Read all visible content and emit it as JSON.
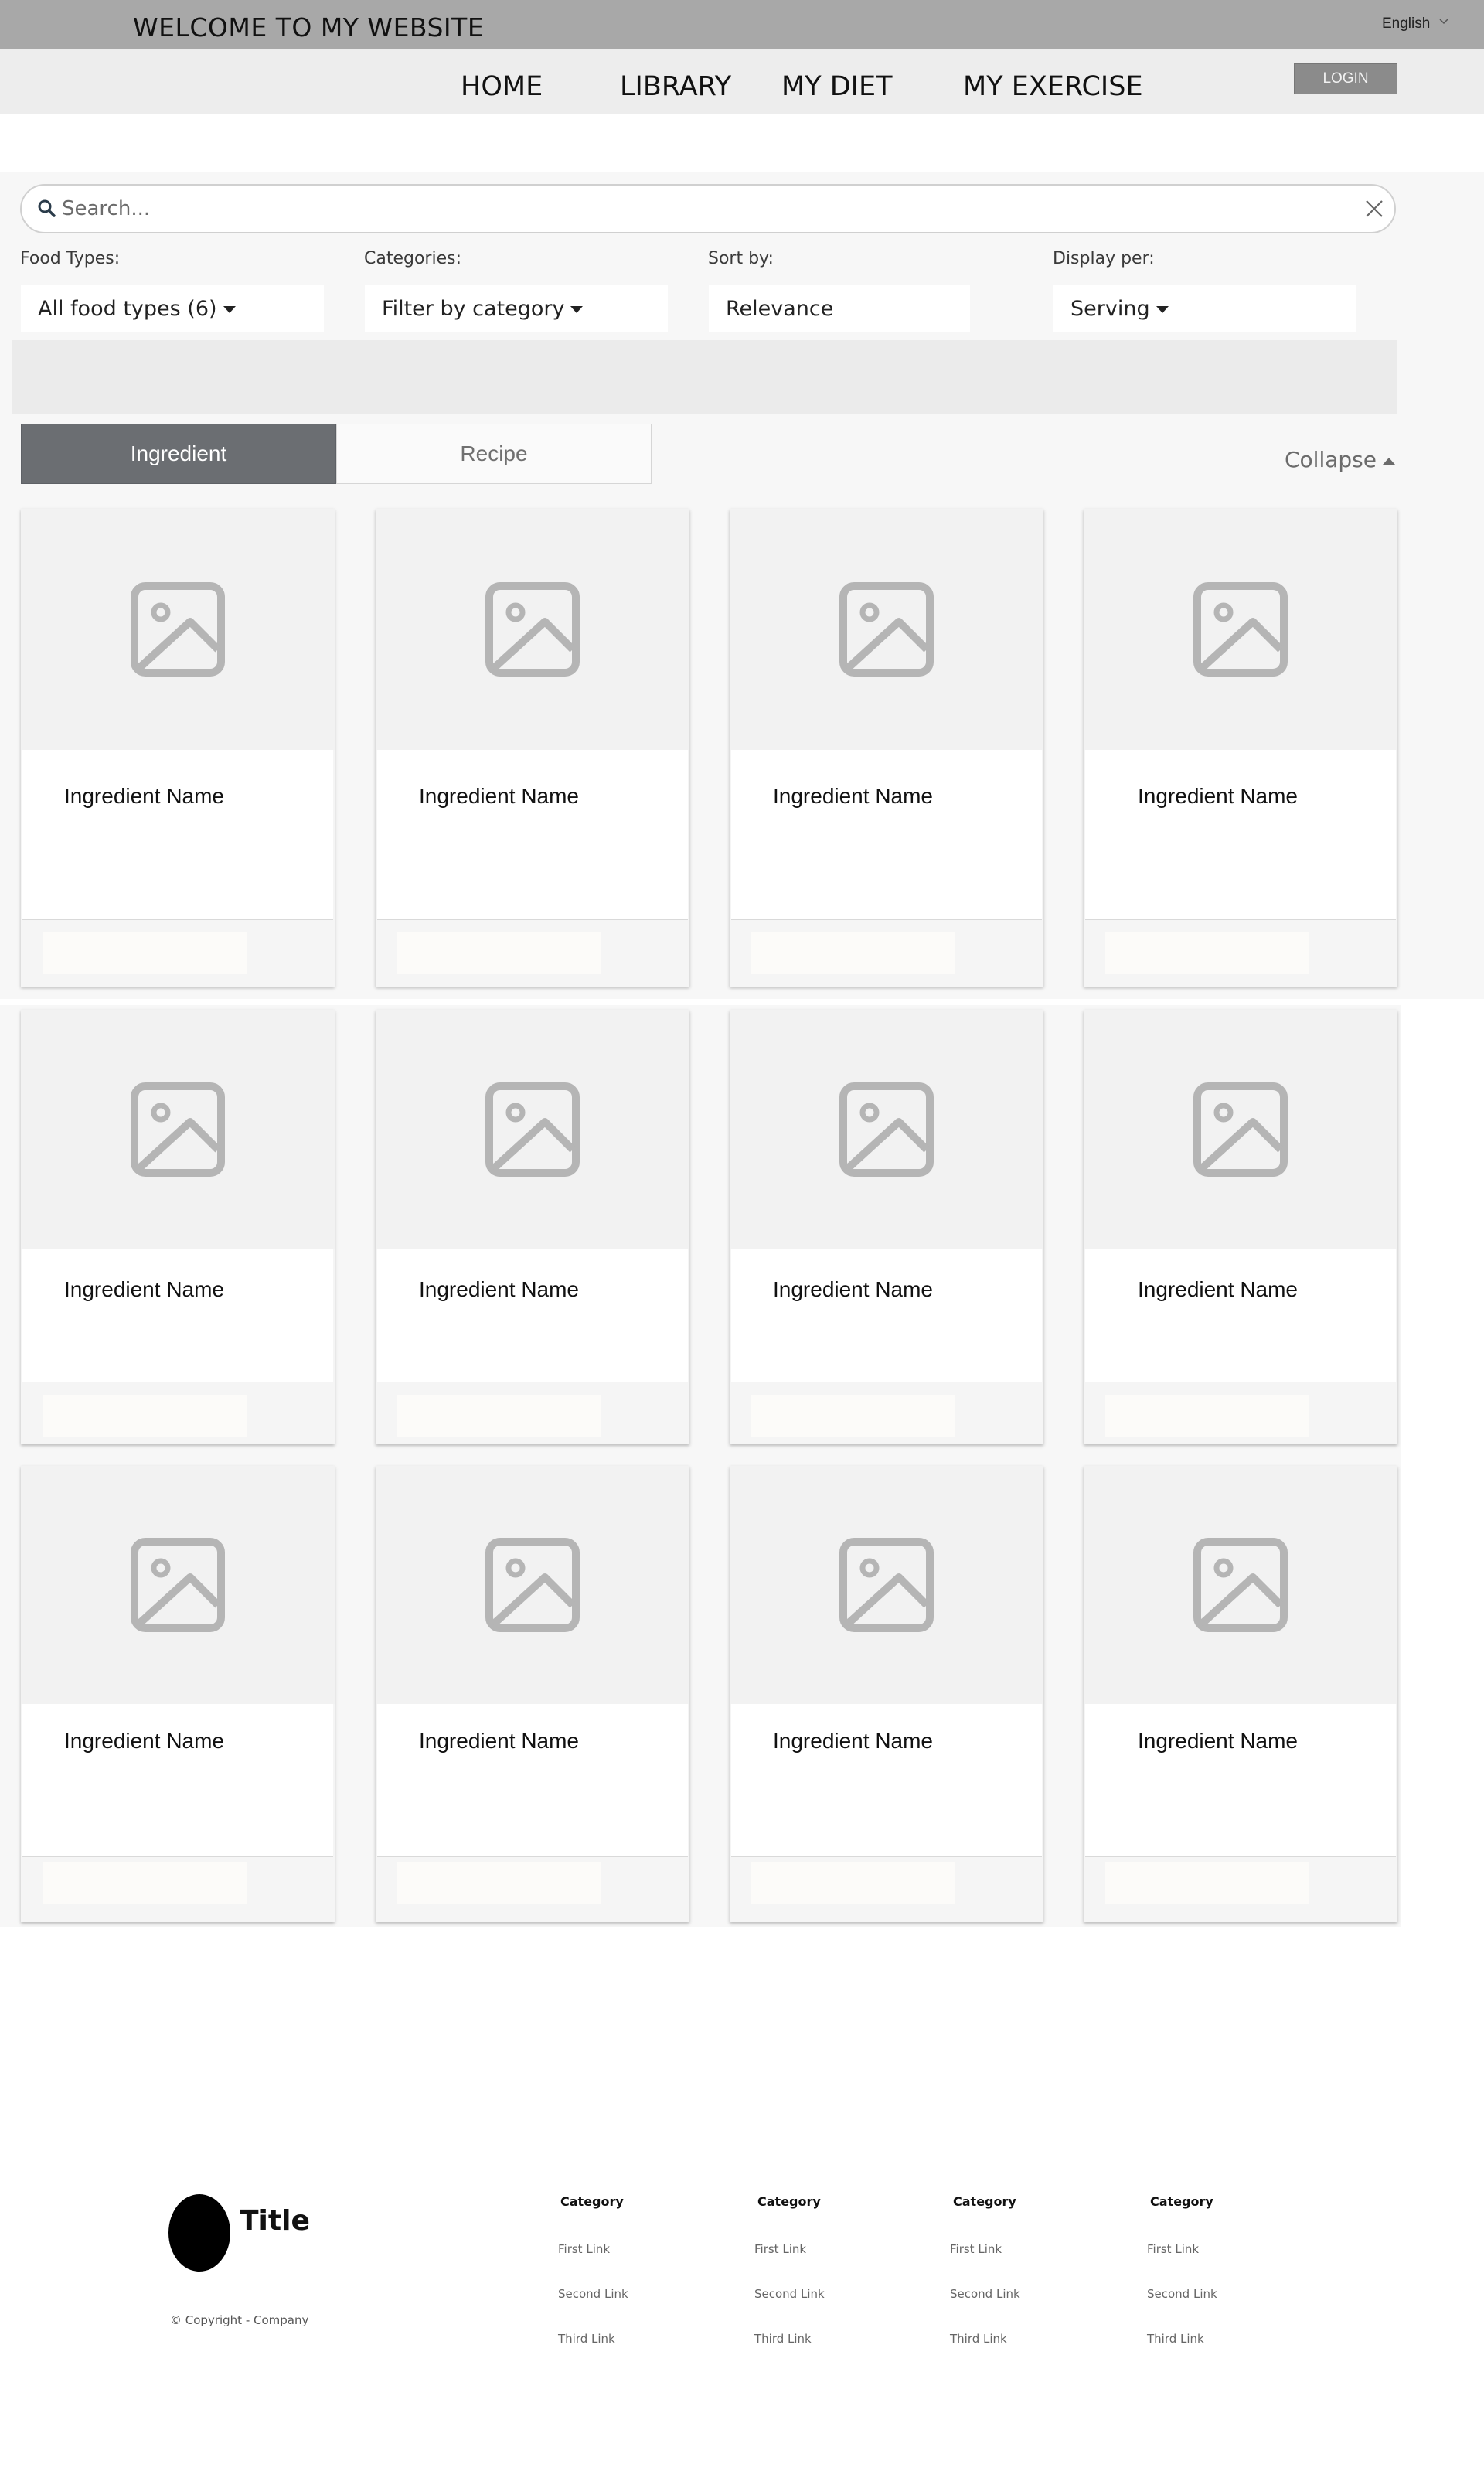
{
  "header": {
    "site_title": "WELCOME TO MY WEBSITE",
    "language": "English",
    "login_label": "LOGIN"
  },
  "nav": {
    "items": [
      {
        "label": "HOME"
      },
      {
        "label": "LIBRARY"
      },
      {
        "label": "MY DIET"
      },
      {
        "label": "MY EXERCISE"
      }
    ]
  },
  "search": {
    "placeholder": "Search...",
    "value": ""
  },
  "filters": [
    {
      "label": "Food Types:",
      "value": "All food types (6)",
      "has_caret": true
    },
    {
      "label": "Categories:",
      "value": "Filter by category",
      "has_caret": true
    },
    {
      "label": "Sort by:",
      "value": "Relevance",
      "has_caret": false
    },
    {
      "label": "Display per:",
      "value": "Serving",
      "has_caret": true
    }
  ],
  "tabs": {
    "active": "Ingredient",
    "inactive": "Recipe"
  },
  "collapse_label": "Collapse",
  "cards": [
    {
      "name": "Ingredient Name"
    },
    {
      "name": "Ingredient Name"
    },
    {
      "name": "Ingredient Name"
    },
    {
      "name": "Ingredient Name"
    },
    {
      "name": "Ingredient Name"
    },
    {
      "name": "Ingredient Name"
    },
    {
      "name": "Ingredient Name"
    },
    {
      "name": "Ingredient Name"
    },
    {
      "name": "Ingredient Name"
    },
    {
      "name": "Ingredient Name"
    },
    {
      "name": "Ingredient Name"
    },
    {
      "name": "Ingredient Name"
    }
  ],
  "footer": {
    "title": "Title",
    "copyright": "© Copyright - Company",
    "columns": [
      {
        "category": "Category",
        "links": [
          "First Link",
          "Second Link",
          "Third Link"
        ]
      },
      {
        "category": "Category",
        "links": [
          "First Link",
          "Second Link",
          "Third Link"
        ]
      },
      {
        "category": "Category",
        "links": [
          "First Link",
          "Second Link",
          "Third Link"
        ]
      },
      {
        "category": "Category",
        "links": [
          "First Link",
          "Second Link",
          "Third Link"
        ]
      }
    ]
  },
  "colors": {
    "topbar": "#a8a8a8",
    "navbar": "#ededed",
    "login_button": "#8b8b8b",
    "active_tab": "#6b6e72",
    "image_placeholder_icon": "#b5b5b5"
  }
}
